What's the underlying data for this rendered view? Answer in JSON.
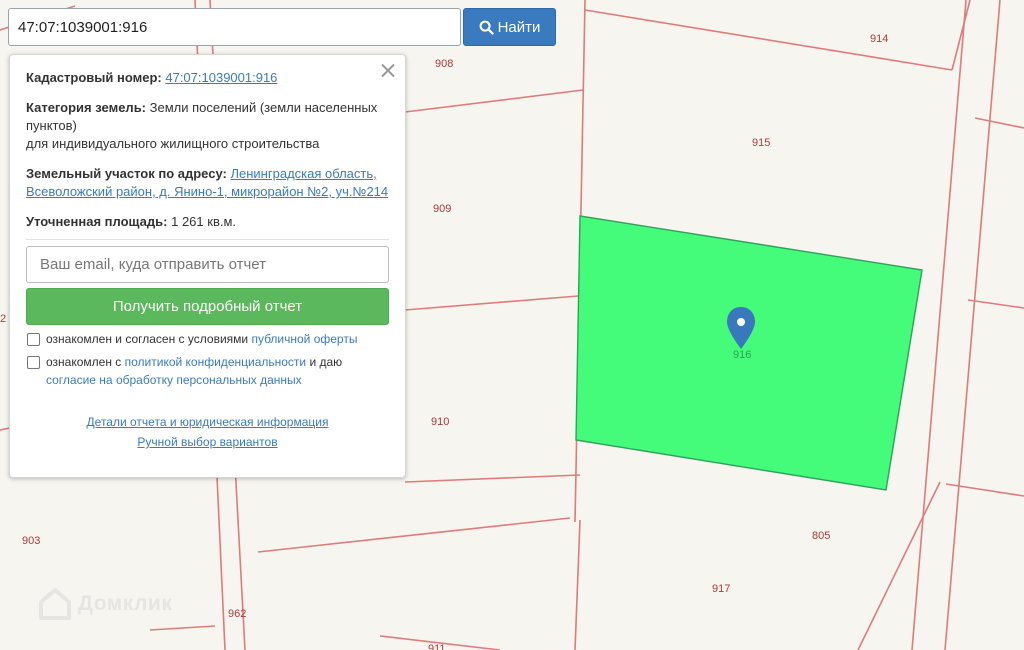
{
  "search": {
    "query": "47:07:1039001:916",
    "button_label": "Найти"
  },
  "info": {
    "cadastral": {
      "label": "Кадастровый номер:",
      "value": "47:07:1039001:916"
    },
    "category": {
      "label": "Категория земель:",
      "value": "Земли поселений (земли населенных пунктов)",
      "value2": "для индивидуального жилищного строительства"
    },
    "address": {
      "label": "Земельный участок по адресу:",
      "value": "Ленинградская область, Всеволожский район, д. Янино-1, микрорайон №2, уч.№214"
    },
    "area": {
      "label": "Уточненная площадь:",
      "value": "1 261 кв.м."
    }
  },
  "form": {
    "email_placeholder": "Ваш email, куда отправить отчет",
    "submit_label": "Получить подробный отчет",
    "consent1": {
      "text": "ознакомлен и согласен с условиями",
      "link": "публичной оферты"
    },
    "consent2": {
      "text_before": "ознакомлен с",
      "link1": "политикой конфиденциальности",
      "text_mid": "и даю",
      "link2": "согласие на обработку персональных данных"
    }
  },
  "links": {
    "details": "Детали отчета и юридическая информация",
    "manual": "Ручной выбор вариантов"
  },
  "map": {
    "labels": [
      "914",
      "908",
      "915",
      "909",
      "916",
      "910",
      "903",
      "805",
      "917",
      "962",
      "911",
      "2"
    ],
    "highlight_color": "#44fb7a",
    "boundary_color": "#e07070",
    "marker_color": "#3a78bc"
  },
  "brand": {
    "name": "Домклик"
  }
}
